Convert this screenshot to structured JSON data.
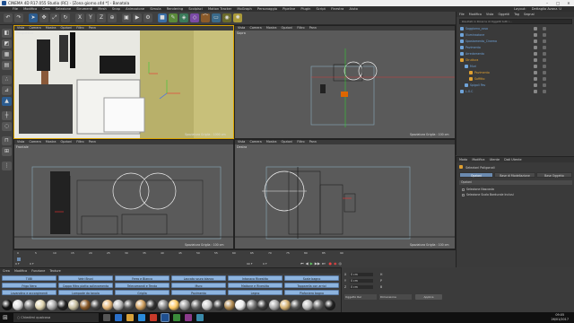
{
  "window": {
    "title": "CINEMA 4D R17.055 Studio (RC) - [Zona giorno.c4d *] - Banatala",
    "ctl_min": "–",
    "ctl_max": "□",
    "ctl_close": "✕"
  },
  "menubar": {
    "items": [
      "File",
      "Modifica",
      "Crea",
      "Selezione",
      "Strumenti",
      "Mesh",
      "Snap",
      "Animazione",
      "Simula",
      "Rendering",
      "Scolpisci",
      "Motion Tracker",
      "MoGraph",
      "Personaggio",
      "Pipeline",
      "Plugin",
      "Script",
      "Finestra",
      "Aiuto"
    ],
    "layout_label": "Layout:",
    "layout_value": "Dettaglio Avanz. U"
  },
  "viewports": [
    {
      "menu": [
        "Vista",
        "Camera",
        "Mostra",
        "Opzioni",
        "Filtro",
        "Pann"
      ],
      "label": "Prospettiva",
      "info": "Spaziatura Griglia : 1000 cm"
    },
    {
      "menu": [
        "Vista",
        "Camera",
        "Mostra",
        "Opzioni",
        "Filtro",
        "Pann"
      ],
      "label": "Sopra",
      "info": "Spaziatura Griglia : 100 cm"
    },
    {
      "menu": [
        "Vista",
        "Camera",
        "Mostra",
        "Opzioni",
        "Filtro",
        "Pann"
      ],
      "label": "Frontale",
      "info": "Spaziatura Griglia : 100 cm"
    },
    {
      "menu": [
        "Vista",
        "Camera",
        "Mostra",
        "Opzioni",
        "Filtro",
        "Pann"
      ],
      "label": "Destra",
      "info": "Spaziatura Griglia : 100 cm"
    }
  ],
  "object_manager": {
    "menu": [
      "File",
      "Modifica",
      "Vista",
      "Oggetti",
      "Tag",
      "Segnal"
    ],
    "search_placeholder": "Risultati in Ricerca di Oggetti tutti i...",
    "objects": [
      {
        "name": "Soggiorno_cosa",
        "color": "#6fa3d9",
        "indent": 0
      },
      {
        "name": "Illuminazione",
        "color": "#6fa3d9",
        "indent": 0
      },
      {
        "name": "Spostamento_Cinema",
        "color": "#6fa3d9",
        "indent": 0
      },
      {
        "name": "Pavimento",
        "color": "#6fa3d9",
        "indent": 0
      },
      {
        "name": "Arredamento",
        "color": "#6fa3d9",
        "indent": 0
      },
      {
        "name": "Struttura",
        "color": "#e0a030",
        "indent": 0
      },
      {
        "name": "Muri",
        "color": "#6fa3d9",
        "indent": 1
      },
      {
        "name": "Pavimento",
        "color": "#e0a030",
        "indent": 2
      },
      {
        "name": "Soffitto",
        "color": "#e0a030",
        "indent": 2
      },
      {
        "name": "Spigoli Pav",
        "color": "#6fa3d9",
        "indent": 1
      },
      {
        "name": "L.O.C",
        "color": "#6fa3d9",
        "indent": 0
      }
    ]
  },
  "attribute_manager": {
    "menu": [
      "Modo",
      "Modifica",
      "Utente",
      "Dati Utente"
    ],
    "header": "Selezioni Poligonali",
    "tabs": [
      "Opzioni",
      "Base di Modellazione",
      "Base Oggetto"
    ],
    "section": "Opzioni",
    "options": [
      "Selezione Nascosta",
      "Selezione Scala Bordurale Inclusi"
    ]
  },
  "timeline": {
    "ticks": [
      "0",
      "5",
      "10",
      "15",
      "20",
      "25",
      "30",
      "35",
      "40",
      "45",
      "50",
      "55",
      "60",
      "65",
      "70",
      "75",
      "80",
      "85",
      "90"
    ],
    "frame_start": "0 F",
    "frame_current": "0 F",
    "frame_end": "90 F",
    "frame_total": "0 F"
  },
  "material_manager": {
    "menu": [
      "Crea",
      "Modifica",
      "Funzione",
      "Texture"
    ],
    "tags": [
      [
        "TUBI",
        "Vetri Bruni",
        "Ferro e Bianco",
        "Laccato scuro bianco",
        "Intonaco Rivestito",
        "Scale bagno"
      ],
      [
        "Frigo Nero",
        "Cappa filtro piatto sollevamento",
        "Telecomandi e Tenda",
        "Muro",
        "Mattone e Rivestito",
        "Tapparella con arriol"
      ],
      [
        "Lavandino e accorgimenti",
        "Lampade da tavola",
        "Griglia",
        "Pavimento",
        "Legno",
        "Plafoniera bagno"
      ]
    ]
  },
  "coordinates": {
    "labels": [
      "X",
      "Y",
      "Z"
    ],
    "values": [
      "0 cm",
      "0 cm",
      "0 cm"
    ],
    "size_labels": [
      "H",
      "P",
      "B"
    ],
    "mode_label": "Oggetto Rel",
    "size_mode": "Dimensione",
    "apply": "Applica"
  },
  "taskbar": {
    "search_placeholder": "Chiedimi qualcosa",
    "time": "09:05",
    "date": "26/01/2017"
  },
  "colors": {
    "accent": "#d9a200",
    "selection": "#6b8bb0",
    "material_tag": "#8db4df"
  }
}
